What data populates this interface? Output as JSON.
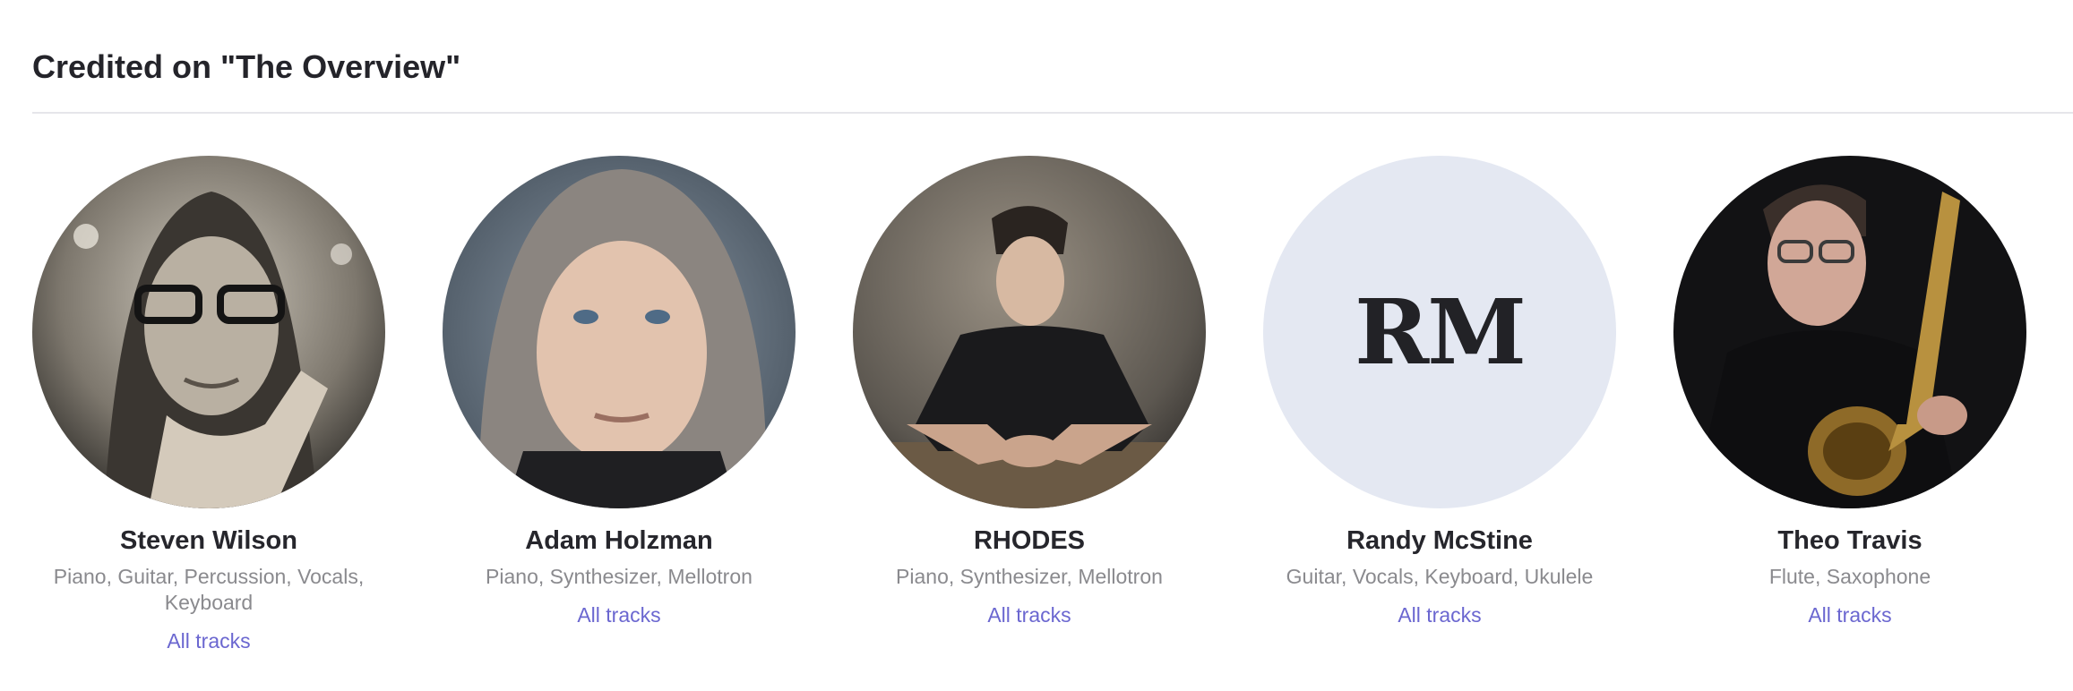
{
  "section": {
    "title": "Credited on \"The Overview\""
  },
  "credits": [
    {
      "name": "Steven Wilson",
      "roles": "Piano, Guitar, Percussion, Vocals, Keyboard",
      "link": "All tracks",
      "avatar": "photo"
    },
    {
      "name": "Adam Holzman",
      "roles": "Piano, Synthesizer, Mellotron",
      "link": "All tracks",
      "avatar": "photo"
    },
    {
      "name": "RHODES",
      "roles": "Piano, Synthesizer, Mellotron",
      "link": "All tracks",
      "avatar": "photo"
    },
    {
      "name": "Randy McStine",
      "roles": "Guitar, Vocals, Keyboard, Ukulele",
      "link": "All tracks",
      "avatar": "initials",
      "initials": "RM"
    },
    {
      "name": "Theo Travis",
      "roles": "Flute, Saxophone",
      "link": "All tracks",
      "avatar": "photo"
    }
  ],
  "colors": {
    "link": "#6b67d0",
    "initials_background": "#e4e8f2",
    "muted_text": "#8a8a8e"
  }
}
